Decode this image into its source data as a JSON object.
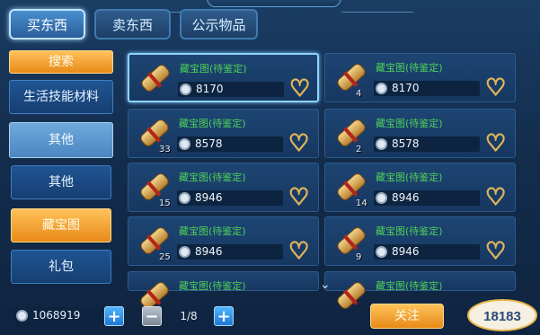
{
  "window": {
    "title": ""
  },
  "tabs": [
    {
      "label": "买东西",
      "active": true
    },
    {
      "label": "卖东西",
      "active": false
    },
    {
      "label": "公示物品",
      "active": false
    }
  ],
  "sidebar": {
    "search_label": "搜索",
    "categories": [
      {
        "label": "生活技能材料",
        "style": "blue"
      },
      {
        "label": "其他",
        "style": "lightblue"
      },
      {
        "label": "其他",
        "style": "blue"
      },
      {
        "label": "藏宝图",
        "style": "orange"
      },
      {
        "label": "礼包",
        "style": "blue"
      }
    ]
  },
  "items": [
    {
      "name": "藏宝图(待鉴定)",
      "price": "8170",
      "qty": "",
      "selected": true
    },
    {
      "name": "藏宝图(待鉴定)",
      "price": "8170",
      "qty": "4",
      "selected": false
    },
    {
      "name": "藏宝图(待鉴定)",
      "price": "8578",
      "qty": "33",
      "selected": false
    },
    {
      "name": "藏宝图(待鉴定)",
      "price": "8578",
      "qty": "2",
      "selected": false
    },
    {
      "name": "藏宝图(待鉴定)",
      "price": "8946",
      "qty": "15",
      "selected": false
    },
    {
      "name": "藏宝图(待鉴定)",
      "price": "8946",
      "qty": "14",
      "selected": false
    },
    {
      "name": "藏宝图(待鉴定)",
      "price": "8946",
      "qty": "25",
      "selected": false
    },
    {
      "name": "藏宝图(待鉴定)",
      "price": "8946",
      "qty": "9",
      "selected": false
    },
    {
      "name": "藏宝图(待鉴定)",
      "price": "",
      "qty": "",
      "selected": false
    },
    {
      "name": "藏宝图(待鉴定)",
      "price": "",
      "qty": "",
      "selected": false
    }
  ],
  "footer": {
    "gold_amount": "1068919",
    "page_indicator": "1/8",
    "follow_label": "关注",
    "watermark_text": "18183"
  },
  "colors": {
    "accent_orange": "#f0a030",
    "item_name_green": "#4ed05a",
    "heart_gold": "#d9a94c"
  },
  "icons": {
    "coin": "silver-coin-icon",
    "heart": "heart-outline-icon",
    "scroll": "treasure-map-scroll-icon",
    "plus": "plus-icon",
    "minus": "minus-icon",
    "chevron": "chevron-down-icon"
  }
}
